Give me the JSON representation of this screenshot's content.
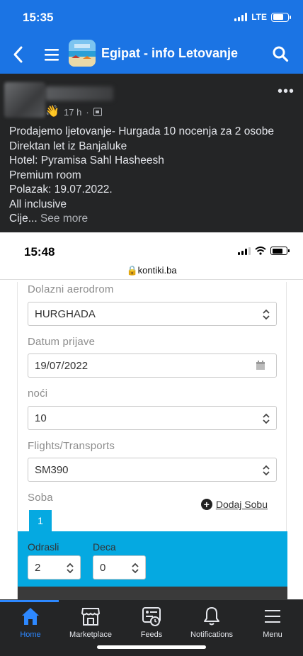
{
  "status_bar": {
    "time": "15:35",
    "network": "LTE",
    "battery_pct": 70
  },
  "header": {
    "title": "Egipat - info Letovanje"
  },
  "post": {
    "time": "17 h",
    "lines": [
      "Prodajemo ljetovanje- Hurgada 10 nocenja za 2 osobe",
      "Direktan let iz Banjaluke",
      "Hotel: Pyramisa Sahl Hasheesh",
      "Premium room",
      "Polazak: 19.07.2022.",
      "All inclusive"
    ],
    "truncated_line": "Cije...",
    "see_more": "See more"
  },
  "screenshot": {
    "time": "15:48",
    "url": "kontiki.ba",
    "fields": [
      {
        "label": "Dolazni aerodrom",
        "value": "HURGHADA"
      },
      {
        "label": "Datum prijave",
        "value": "19/07/2022"
      },
      {
        "label": "noći",
        "value": "10"
      },
      {
        "label": "Flights/Transports",
        "value": "SM390"
      }
    ],
    "room_label": "Soba",
    "add_room": "Dodaj Sobu",
    "room_tab": "1",
    "adults_label": "Odrasli",
    "adults_value": "2",
    "kids_label": "Deca",
    "kids_value": "0"
  },
  "tabs": [
    {
      "label": "Home",
      "icon": "home-icon",
      "active": true
    },
    {
      "label": "Marketplace",
      "icon": "marketplace-icon",
      "active": false
    },
    {
      "label": "Feeds",
      "icon": "feeds-icon",
      "active": false
    },
    {
      "label": "Notifications",
      "icon": "bell-icon",
      "active": false
    },
    {
      "label": "Menu",
      "icon": "menu-icon",
      "active": false
    }
  ],
  "colors": {
    "brand": "#1b74e4",
    "active_tab": "#2d88ff",
    "kontiki_blue": "#05a9e1"
  }
}
